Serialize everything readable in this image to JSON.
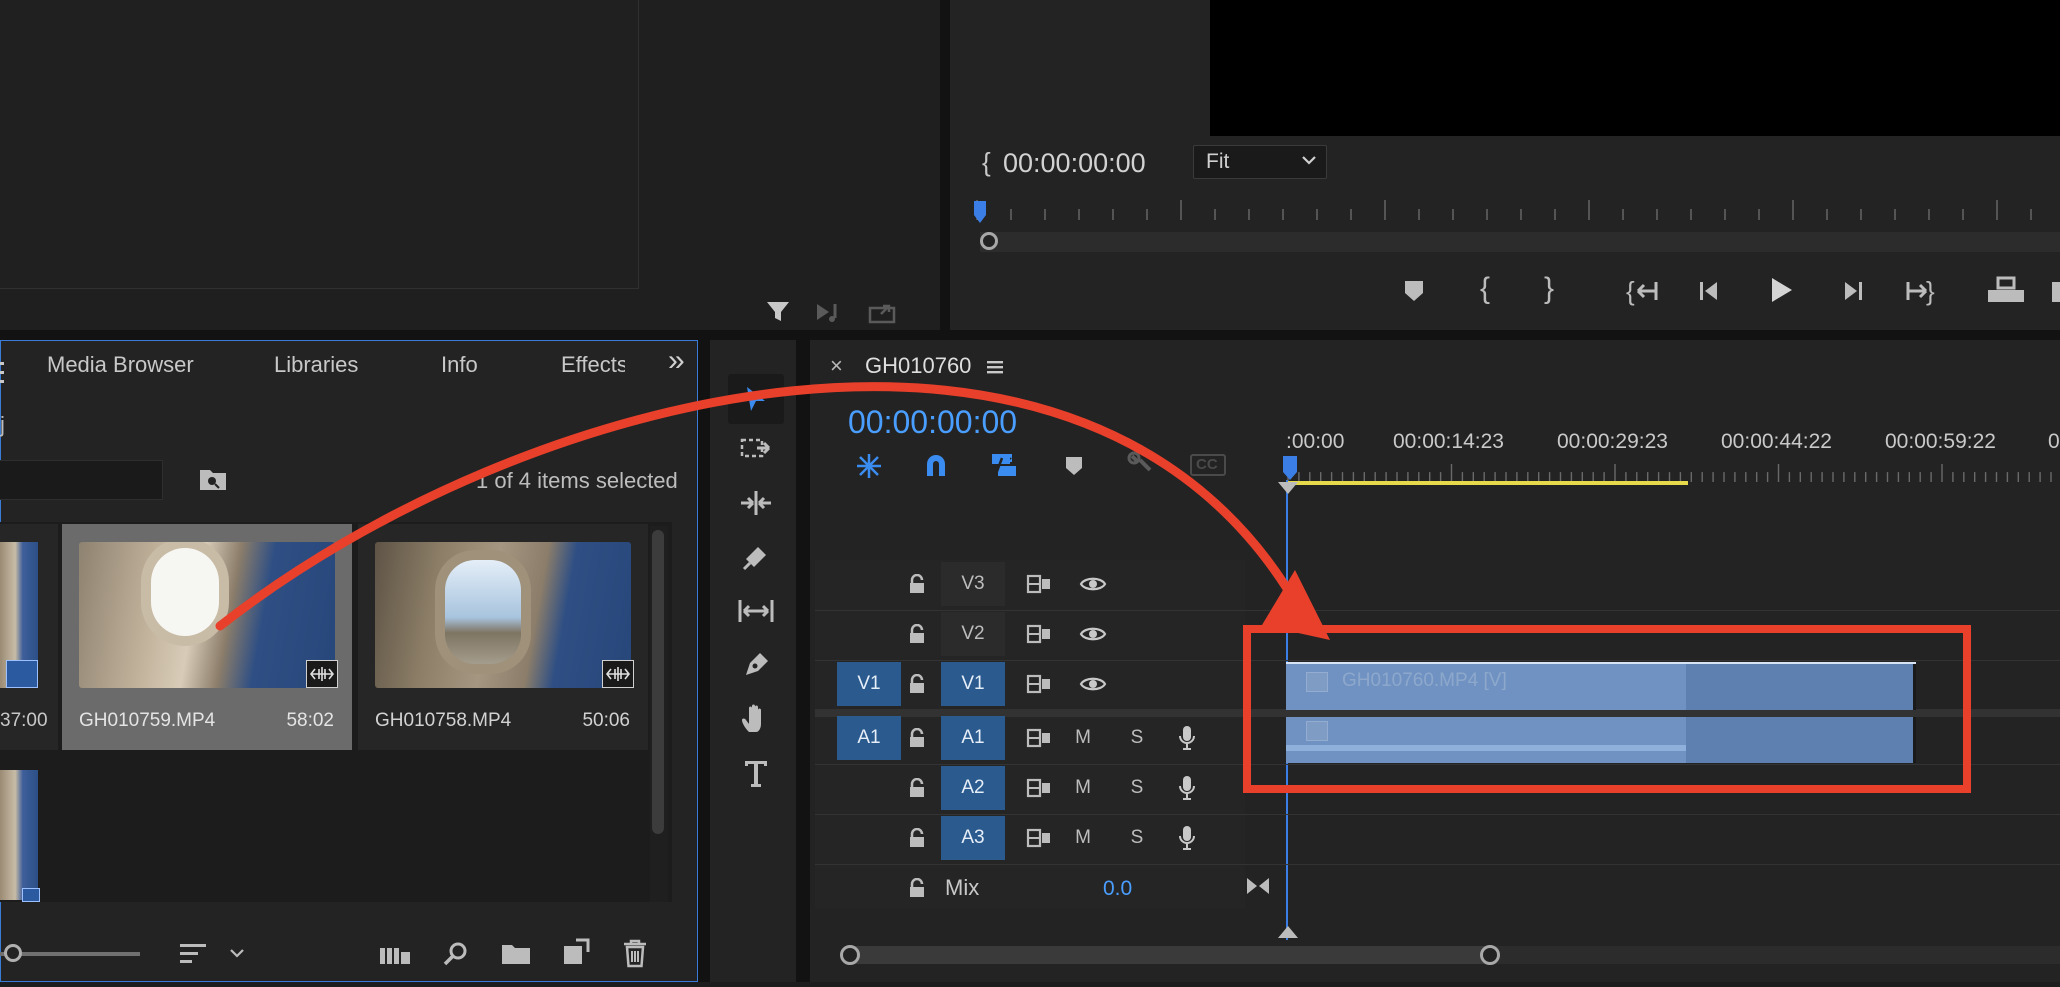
{
  "program_monitor": {
    "timecode": "00:00:00:00",
    "zoom_select": "Fit"
  },
  "project_panel": {
    "tabs": [
      "Media Browser",
      "Libraries",
      "Info",
      "Effects"
    ],
    "overflow_label": "»",
    "project_name_fragment": "j",
    "selection_status": "1 of 4 items selected",
    "left_clip_duration_fragment": "37:00",
    "items": [
      {
        "name": "GH010759.MP4",
        "duration": "58:02",
        "selected": true
      },
      {
        "name": "GH010758.MP4",
        "duration": "50:06",
        "selected": false
      }
    ]
  },
  "timeline": {
    "sequence_name": "GH010760",
    "close_label": "×",
    "playhead_timecode": "00:00:00:00",
    "ruler_labels": [
      ":00:00",
      "00:00:14:23",
      "00:00:29:23",
      "00:00:44:22",
      "00:00:59:22"
    ],
    "video_tracks": [
      {
        "name": "V3",
        "source": ""
      },
      {
        "name": "V2",
        "source": ""
      },
      {
        "name": "V1",
        "source": "V1"
      }
    ],
    "audio_tracks": [
      {
        "name": "A1",
        "source": "A1",
        "m": "M",
        "s": "S"
      },
      {
        "name": "A2",
        "source": "",
        "m": "M",
        "s": "S"
      },
      {
        "name": "A3",
        "source": "",
        "m": "M",
        "s": "S"
      }
    ],
    "mix_label": "Mix",
    "mix_value": "0.0",
    "clip_label": "GH010760.MP4 [V]",
    "cc_label": "CC"
  },
  "colors": {
    "accent_blue": "#4aa0ff",
    "track_blue": "#2a5a8e",
    "clip_fill": "#5e80b0",
    "annotation_red": "#e8402a",
    "work_area_yellow": "#e6d94a"
  }
}
